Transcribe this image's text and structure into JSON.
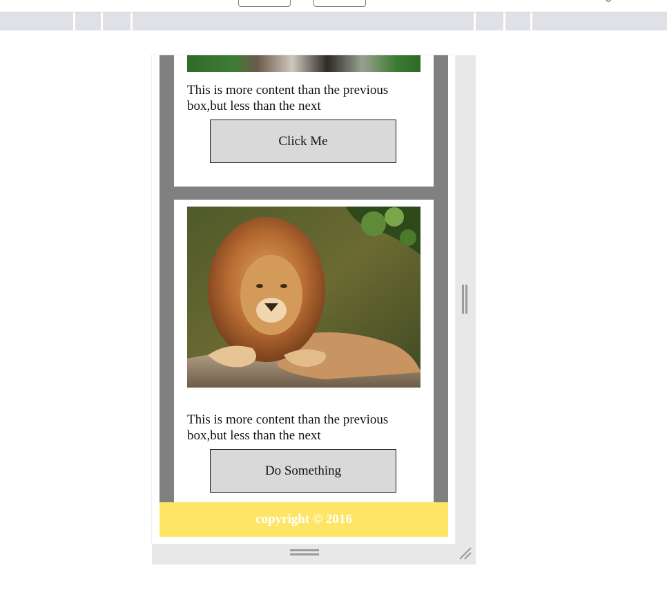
{
  "cards": [
    {
      "text": "This is more content than the previous box,but less than the next",
      "button_label": "Click Me"
    },
    {
      "text": "This is more content than the previous box,but less than the next",
      "button_label": "Do Something"
    }
  ],
  "footer": {
    "text": "copyright © 2016"
  },
  "colors": {
    "column_grey": "#808080",
    "footer_yellow": "#ffe566",
    "button_bg": "#d9d9d9",
    "frame_bg": "#e8e8e8"
  },
  "icons": [
    "lion-image",
    "animal-image-partial",
    "side-resize-handle-icon",
    "bottom-resize-handle-icon",
    "corner-resize-handle-icon"
  ]
}
